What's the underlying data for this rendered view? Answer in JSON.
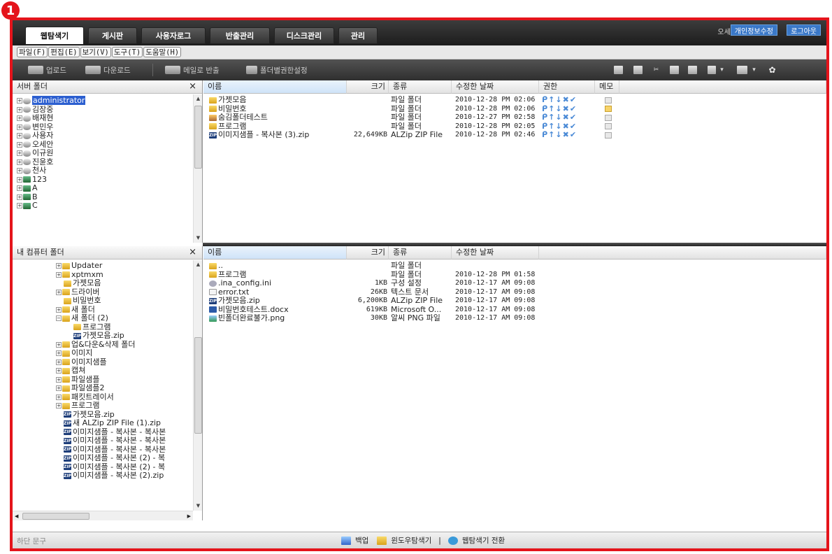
{
  "callout": "1",
  "tabs": [
    "웹탐색기",
    "게시판",
    "사용자로그",
    "반출관리",
    "디스크관리",
    "관리"
  ],
  "user": {
    "name": "오세안",
    "profile_button": "개인정보수정",
    "logout_button": "로그아웃"
  },
  "menu": [
    "파일(F)",
    "편집(E)",
    "보기(V)",
    "도구(T)",
    "도움말(H)"
  ],
  "toolbar": {
    "upload": "업로드",
    "download": "다운로드",
    "email": "메일로 반출",
    "perm": "폴더별권한설정"
  },
  "server_panel": {
    "title": "서버 폴더",
    "close": "×",
    "tree": [
      {
        "label": "administrator",
        "icon": "drive",
        "selected": true
      },
      {
        "label": "김장중",
        "icon": "drive"
      },
      {
        "label": "배재현",
        "icon": "drive"
      },
      {
        "label": "변민우",
        "icon": "drive"
      },
      {
        "label": "사용자",
        "icon": "drive"
      },
      {
        "label": "오세안",
        "icon": "drive"
      },
      {
        "label": "이규원",
        "icon": "drive"
      },
      {
        "label": "진윤호",
        "icon": "drive"
      },
      {
        "label": "천사",
        "icon": "drive"
      },
      {
        "label": "123",
        "icon": "net"
      },
      {
        "label": "A",
        "icon": "net"
      },
      {
        "label": "B",
        "icon": "net"
      },
      {
        "label": "C",
        "icon": "net"
      }
    ]
  },
  "server_files": {
    "columns": [
      "이름",
      "크기",
      "종류",
      "수정한 날짜",
      "권한",
      "메모"
    ],
    "rows": [
      {
        "name": "가젯모음",
        "icon": "folder",
        "size": "",
        "type": "파일 폴더",
        "date": "2010-12-28 PM 02:06",
        "perm": "ᑭ↑↓✖✔",
        "memo": false
      },
      {
        "name": "비밀번호",
        "icon": "folder",
        "size": "",
        "type": "파일 폴더",
        "date": "2010-12-28 PM 02:06",
        "perm": "ᑭ↑↓✖✔",
        "memo": true
      },
      {
        "name": "숨김폴더테스트",
        "icon": "users",
        "size": "",
        "type": "파일 폴더",
        "date": "2010-12-27 PM 02:58",
        "perm": "ᑭ↑↓✖✔",
        "memo": false
      },
      {
        "name": "프로그램",
        "icon": "folder",
        "size": "",
        "type": "파일 폴더",
        "date": "2010-12-28 PM 02:05",
        "perm": "ᑭ↑↓✖✔",
        "memo": false
      },
      {
        "name": "이미지샘플 - 복사본 (3).zip",
        "icon": "zip",
        "size": "22,649KB",
        "type": "ALZip ZIP File",
        "date": "2010-12-28 PM 02:46",
        "perm": "ᑭ↑↓✖✔",
        "memo": false
      }
    ]
  },
  "local_panel": {
    "title": "내 컴퓨터 폴더",
    "close": "×",
    "tree": [
      {
        "label": "Updater",
        "icon": "folder",
        "indent": 5,
        "plus": true
      },
      {
        "label": "xptmxm",
        "icon": "folder",
        "indent": 5,
        "plus": true
      },
      {
        "label": "가젯모음",
        "icon": "folder",
        "indent": 5
      },
      {
        "label": "드라이버",
        "icon": "folder",
        "indent": 5,
        "plus": true
      },
      {
        "label": "비밀번호",
        "icon": "folder",
        "indent": 5
      },
      {
        "label": "새 폴더",
        "icon": "folder",
        "indent": 5,
        "plus": true
      },
      {
        "label": "새 폴더 (2)",
        "icon": "folder",
        "indent": 5,
        "minus": true
      },
      {
        "label": "프로그램",
        "icon": "folder",
        "indent": 6
      },
      {
        "label": "가젯모음.zip",
        "icon": "zip",
        "indent": 6
      },
      {
        "label": "업&다운&삭제 폴더",
        "icon": "folder",
        "indent": 5,
        "plus": true
      },
      {
        "label": "이미지",
        "icon": "folder",
        "indent": 5,
        "plus": true
      },
      {
        "label": "이미지샘플",
        "icon": "folder",
        "indent": 5,
        "plus": true
      },
      {
        "label": "캡쳐",
        "icon": "folder",
        "indent": 5,
        "plus": true
      },
      {
        "label": "파일샘플",
        "icon": "folder",
        "indent": 5,
        "plus": true
      },
      {
        "label": "파일샘플2",
        "icon": "folder",
        "indent": 5,
        "plus": true
      },
      {
        "label": "패킷트레이서",
        "icon": "folder",
        "indent": 5,
        "plus": true
      },
      {
        "label": "프로그램",
        "icon": "folder",
        "indent": 5,
        "plus": true
      },
      {
        "label": "가젯모음.zip",
        "icon": "zip",
        "indent": 5
      },
      {
        "label": "새 ALZip ZIP File (1).zip",
        "icon": "zip",
        "indent": 5
      },
      {
        "label": "이미지샘플 - 복사본 - 복사본",
        "icon": "zip",
        "indent": 5
      },
      {
        "label": "이미지샘플 - 복사본 - 복사본",
        "icon": "zip",
        "indent": 5
      },
      {
        "label": "이미지샘플 - 복사본 - 복사본",
        "icon": "zip",
        "indent": 5
      },
      {
        "label": "이미지샘플 - 복사본 (2) - 복",
        "icon": "zip",
        "indent": 5
      },
      {
        "label": "이미지샘플 - 복사본 (2) - 복",
        "icon": "zip",
        "indent": 5
      },
      {
        "label": "이미지샘플 - 복사본 (2).zip",
        "icon": "zip",
        "indent": 5
      }
    ]
  },
  "local_files": {
    "columns": [
      "이름",
      "크기",
      "종류",
      "수정한 날짜"
    ],
    "rows": [
      {
        "name": "..",
        "icon": "folder",
        "size": "",
        "type": "파일 폴더",
        "date": ""
      },
      {
        "name": "프로그램",
        "icon": "folder",
        "size": "",
        "type": "파일 폴더",
        "date": "2010-12-28 PM 01:58"
      },
      {
        "name": ".ina_config.ini",
        "icon": "gear",
        "size": "1KB",
        "type": "구성 설정",
        "date": "2010-12-17 AM 09:08"
      },
      {
        "name": "error.txt",
        "icon": "txt",
        "size": "26KB",
        "type": "텍스트 문서",
        "date": "2010-12-17 AM 09:08"
      },
      {
        "name": "가젯모음.zip",
        "icon": "zip",
        "size": "6,200KB",
        "type": "ALZip ZIP File",
        "date": "2010-12-17 AM 09:08"
      },
      {
        "name": "비밀번호테스트.docx",
        "icon": "doc",
        "size": "619KB",
        "type": "Microsoft O...",
        "date": "2010-12-17 AM 09:08"
      },
      {
        "name": "빈폴더완료불가.png",
        "icon": "img",
        "size": "30KB",
        "type": "알씨 PNG 파일",
        "date": "2010-12-17 AM 09:08"
      }
    ]
  },
  "footer": {
    "left": "하단 문구",
    "backup": "백업",
    "windows": "윈도우탐색기",
    "sep": "|",
    "switch": "웹탐색기 전환"
  },
  "colors": {
    "frame": "#e4141b",
    "selection": "#2c5fd0",
    "active_button": "#3a78c8"
  }
}
